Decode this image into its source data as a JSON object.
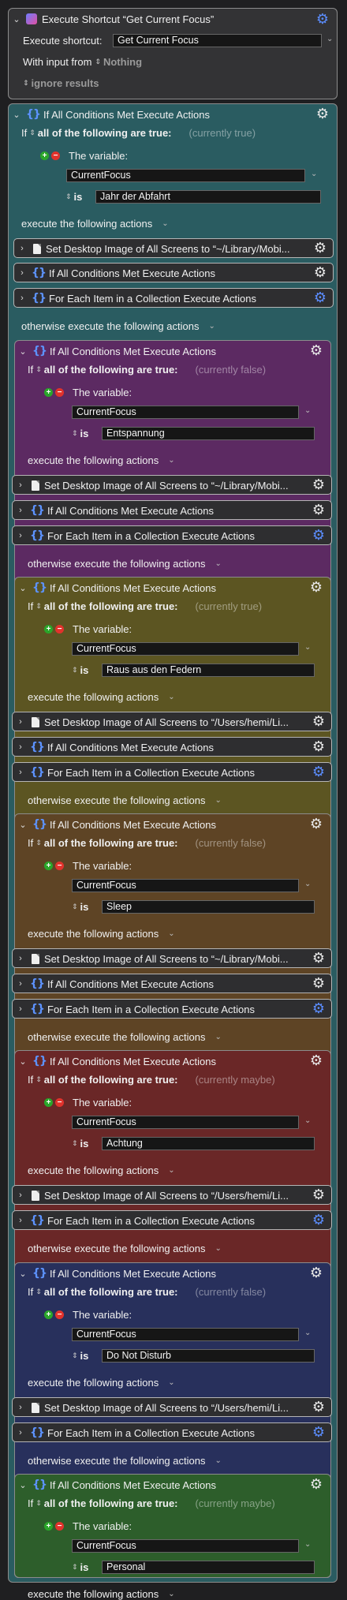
{
  "shortcut": {
    "title": "Execute Shortcut “Get Current Focus”",
    "execute_label": "Execute shortcut:",
    "execute_value": "Get Current Focus",
    "input_label": "With input from",
    "input_value": "Nothing",
    "ignore_label": "ignore results"
  },
  "labels": {
    "if_title": "If All Conditions Met Execute Actions",
    "if_word": "If",
    "all_of": "all of the following are true:",
    "the_variable": "The variable:",
    "is": "is",
    "execute_following": "execute the following actions",
    "otherwise": "otherwise execute the following actions",
    "set_desktop_mobi": "Set Desktop Image of All Screens to “~/Library/Mobi...",
    "set_desktop_users": "Set Desktop Image of All Screens to “/Users/hemi/Li...",
    "if_all": "If All Conditions Met Execute Actions",
    "for_each": "For Each Item in a Collection Execute Actions"
  },
  "conditions": [
    {
      "status": "(currently true)",
      "variable": "CurrentFocus",
      "value": "Jahr der Abfahrt",
      "color": "#2a5c61"
    },
    {
      "status": "(currently false)",
      "variable": "CurrentFocus",
      "value": "Entspannung",
      "color": "#5c2a62"
    },
    {
      "status": "(currently true)",
      "variable": "CurrentFocus",
      "value": "Raus aus den Federn",
      "color": "#5c5522"
    },
    {
      "status": "(currently false)",
      "variable": "CurrentFocus",
      "value": "Sleep",
      "color": "#5e4425"
    },
    {
      "status": "(currently maybe)",
      "variable": "CurrentFocus",
      "value": "Achtung",
      "color": "#6a2727"
    },
    {
      "status": "(currently false)",
      "variable": "CurrentFocus",
      "value": "Do Not Disturb",
      "color": "#28305c"
    },
    {
      "status": "(currently maybe)",
      "variable": "CurrentFocus",
      "value": "Personal",
      "color": "#2d5e2b"
    }
  ]
}
